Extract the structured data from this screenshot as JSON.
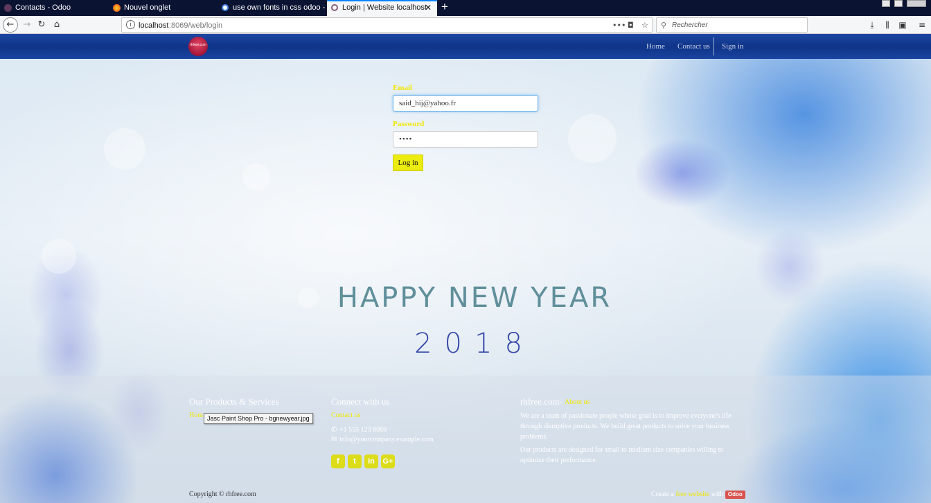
{
  "browser": {
    "tabs": [
      {
        "label": "Contacts - Odoo",
        "active": false
      },
      {
        "label": "Nouvel onglet",
        "active": false
      },
      {
        "label": "use own fonts in css odoo - Reche",
        "active": false
      },
      {
        "label": "Login | Website localhost",
        "active": true
      }
    ],
    "new_tab_icon": "+",
    "url": {
      "host": "localhost",
      "path": ":8069/web/login"
    },
    "search_placeholder": "Rechercher",
    "icons": [
      "back-icon",
      "forward-icon",
      "reload-icon",
      "home-icon",
      "info-icon",
      "more-icon",
      "pocket-icon",
      "star-icon",
      "download-icon",
      "library-icon",
      "sidebar-icon",
      "menu-icon"
    ]
  },
  "site": {
    "logo_text": "rhfree.com",
    "menu": {
      "home": "Home",
      "contact": "Contact us",
      "signin": "Sign in"
    }
  },
  "login": {
    "email_label": "Email",
    "email_value": "said_hij@yahoo.fr",
    "password_label": "Password",
    "password_value": "••••",
    "button": "Log in"
  },
  "greeting": {
    "line1": "HAPPY NEW YEAR",
    "line2": "2018"
  },
  "footer": {
    "products_title": "Our Products & Services",
    "products_link": "Hom",
    "tooltip": "Jasc Paint Shop Pro - bgnewyear.jpg",
    "connect_title": "Connect with us",
    "contact_link": "Contact us",
    "phone": "+1 555 123 8069",
    "email": "info@yourcompany.example.com",
    "social": [
      "facebook-icon",
      "twitter-icon",
      "linkedin-icon",
      "googleplus-icon"
    ],
    "about_company": "rhfree.com",
    "about_sep": " - ",
    "about_link": "About us",
    "about_p1": "We are a team of passionate people whose goal is to improve everyone's life through disruptive products. We build great products to solve your business problems.",
    "about_p2": "Our products are designed for small to medium size companies willing to optimize their performance.",
    "copyright": "Copyright © rhfree.com",
    "create_prefix": "Create a ",
    "create_link": "free website",
    "create_with": " with ",
    "odoo_badge": "Odoo"
  },
  "colors": {
    "accent_yellow": "#f0e800",
    "header_blue": "#0f3488",
    "odoo_red": "#d9534f",
    "tab_active_border": "#0a84ff"
  }
}
